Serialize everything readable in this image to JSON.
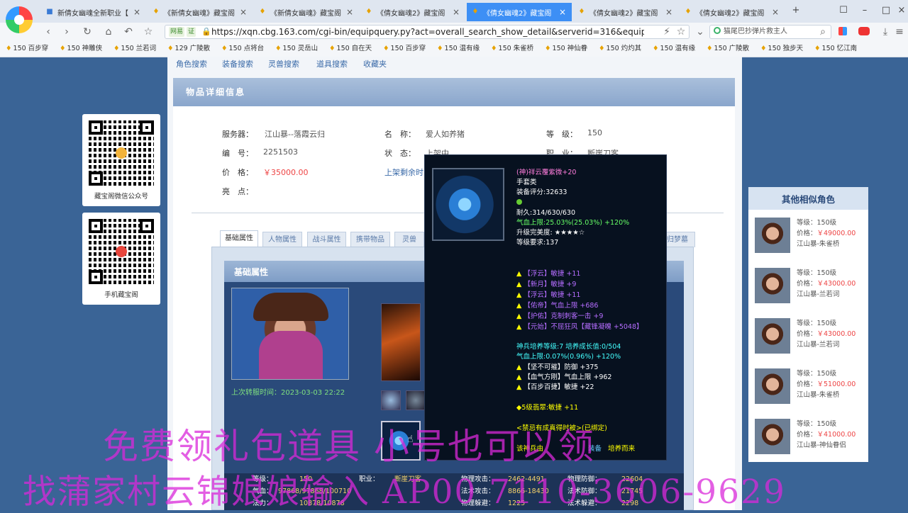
{
  "browser": {
    "tabs": [
      {
        "label": "新倩女幽魂全新职业【"
      },
      {
        "label": "《新倩女幽魂》藏宝阁"
      },
      {
        "label": "《新倩女幽魂》藏宝阁"
      },
      {
        "label": "《倩女幽魂2》藏宝阁"
      },
      {
        "label": "《倩女幽魂2》藏宝阁"
      },
      {
        "label": "《倩女幽魂2》藏宝阁"
      },
      {
        "label": "《倩女幽魂2》藏宝阁"
      }
    ],
    "badge1": "网易",
    "badge2": "证",
    "url": "https://xqn.cbg.163.com/cgi-bin/equipquery.py?act=overall_search_show_detail&serverid=316&equip_id=",
    "search_text": "猫尾巴抄弹片救主人",
    "bookmarks": [
      "150 百步穿",
      "150 神雕侠",
      "150 兰若词",
      "129 广陵散",
      "150 点将台",
      "150 灵岳山",
      "150 自在天",
      "150 百步穿",
      "150 温有缘",
      "150 朱雀桥",
      "150 神仙眷",
      "150 灼灼其",
      "150 温有缘",
      "150 广陵散",
      "150 独步天",
      "150 忆江南"
    ]
  },
  "nav": {
    "links": [
      "角色搜索",
      "装备搜索",
      "灵兽搜索",
      "道具搜索",
      "收藏夹"
    ]
  },
  "detail": {
    "title": "物品详细信息",
    "fields": {
      "server_label": "服务器：",
      "server_value": "江山暴--落霞云归",
      "name_label": "名　称：",
      "name_value": "爱人如养猪",
      "level_label": "等　级：",
      "level_value": "150",
      "id_label": "编　号：",
      "id_value": "2251503",
      "status_label": "状　态：",
      "status_value": "上架中",
      "job_label": "职　业：",
      "job_value": "断崖刀客",
      "price_label": "价　格：",
      "price_value": "￥35000.00",
      "remaining_label": "上架剩余时",
      "highlight_label": "亮　点："
    },
    "tabs": [
      "基础属性",
      "人物属性",
      "战斗属性",
      "携带物品",
      "灵兽",
      "归梦墓"
    ],
    "panel_title": "基础属性",
    "refresh_time": "上次转服时间：2023-03-03 22:22",
    "stats": {
      "row1": {
        "l1": "等级：",
        "v1": "150",
        "l2": "职业：",
        "v2": "断崖刀客",
        "l3": "物理攻击：",
        "v3": "2462-4491",
        "l4": "物理防御：",
        "v4": "22604"
      },
      "row2": {
        "l1": "气血：",
        "v1": "97868/97868/100710",
        "l2": "",
        "v2": "",
        "l3": "法术攻击：",
        "v3": "8866-18430",
        "l4": "法术防御：",
        "v4": "21745"
      },
      "row3": {
        "l1": "法力：",
        "v1": "10878/10878",
        "l2": "",
        "v2": "",
        "l3": "物理躲避：",
        "v3": "1225",
        "l4": "法术躲避：",
        "v4": "2298"
      }
    }
  },
  "tooltip": {
    "lines": [
      {
        "t": "(神)祥云覆紫微+20",
        "c": "tt-pink"
      },
      {
        "t": "手套类",
        "c": "tt-white"
      },
      {
        "t": "装备评分:32633",
        "c": "tt-white"
      },
      {
        "t": "",
        "c": "tt-white"
      },
      {
        "t": "耐久:314/630/630",
        "c": "tt-white"
      },
      {
        "t": "气血上限:25.03%(25.03%) +120%",
        "c": "tt-white"
      },
      {
        "t": "升级完美度: ★★★★☆",
        "c": "tt-white"
      },
      {
        "t": "等级要求:137",
        "c": "tt-white"
      }
    ],
    "attrs": [
      "【浮云】敏捷 +11",
      "【新月】敏捷 +9",
      "【浮云】敏捷 +11",
      "【佑帝】气血上限 +686",
      "【护佑】克制刺客一击 +9",
      "【元始】不屈狂风【藏锋凝魄 +5048】"
    ],
    "refine": [
      {
        "t": "神兵培养等级:7 培养成长值:0/504",
        "c": "tt-cyan"
      },
      {
        "t": "气血上限:0.07%(0.96%) +120%",
        "c": "tt-cyan"
      },
      {
        "t": "【坚不可摧】防御 +375",
        "c": "tt-white"
      },
      {
        "t": "【血气方刚】气血上限 +962",
        "c": "tt-white"
      },
      {
        "t": "【百步百捷】敏捷 +22",
        "c": "tt-white"
      }
    ],
    "gem": "5级翡翠:敏捷 +11",
    "bottom1": "<禁忌有成真得时被>(已绑定)",
    "bottom2": "该神兵由",
    "bottom3": "装备",
    "bottom4": "培养而来"
  },
  "qr": {
    "label1": "藏宝阁微信公众号",
    "label2": "手机藏宝阁"
  },
  "similar": {
    "title": "其他相似角色",
    "items": [
      {
        "level": "等级：150级",
        "price_label": "价格：",
        "price": "￥49000.00",
        "server": "江山暴-朱雀桥"
      },
      {
        "level": "等级：150级",
        "price_label": "价格：",
        "price": "￥43000.00",
        "server": "江山暴-兰若词"
      },
      {
        "level": "等级：150级",
        "price_label": "价格：",
        "price": "￥43000.00",
        "server": "江山暴-兰若词"
      },
      {
        "level": "等级：150级",
        "price_label": "价格：",
        "price": "￥51000.00",
        "server": "江山暴-朱雀桥"
      },
      {
        "level": "等级：150级",
        "price_label": "价格：",
        "price": "￥41000.00",
        "server": "江山暴-神仙眷侣"
      }
    ]
  },
  "overlay": {
    "line1": "免费领礼包道具  小号也可以领",
    "line2": "找蒲家村云锦娘娘输入 AP00 7110-3606-9629"
  }
}
